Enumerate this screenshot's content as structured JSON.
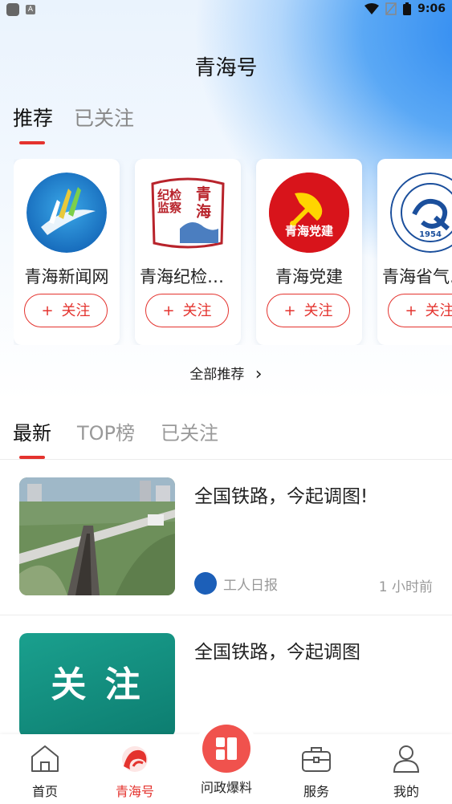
{
  "status_bar": {
    "time": "9:06",
    "left_badge": "A"
  },
  "header": {
    "title": "青海号"
  },
  "top_tabs": [
    {
      "label": "推荐",
      "active": true
    },
    {
      "label": "已关注",
      "active": false
    }
  ],
  "recommend_cards": [
    {
      "name": "青海新闻网",
      "follow_label": "关注",
      "plus": "+"
    },
    {
      "name": "青海纪检监察",
      "follow_label": "关注",
      "plus": "+"
    },
    {
      "name": "青海党建",
      "follow_label": "关注",
      "plus": "+"
    },
    {
      "name": "青海省气象局",
      "follow_label": "关注",
      "plus": "+"
    }
  ],
  "logo_texts": {
    "jijian_left": "纪检监察",
    "jijian_right": "青海",
    "dangjian": "青海党建",
    "qixiang_year": "1954"
  },
  "all_recommend": {
    "label": "全部推荐",
    "arrow": "›"
  },
  "section_tabs": [
    {
      "label": "最新",
      "active": true
    },
    {
      "label": "TOP榜",
      "active": false
    },
    {
      "label": "已关注",
      "active": false
    }
  ],
  "news": [
    {
      "title": "全国铁路，今起调图!",
      "source": "工人日报",
      "time": "1  小时前"
    },
    {
      "title": "全国铁路，今起调图",
      "thumb_text": "关 注"
    }
  ],
  "bottom_nav": [
    {
      "label": "首页",
      "icon": "home-icon"
    },
    {
      "label": "青海号",
      "icon": "qinghai-hao-icon",
      "active": true
    },
    {
      "label": "问政爆料",
      "icon": "report-icon"
    },
    {
      "label": "服务",
      "icon": "briefcase-icon"
    },
    {
      "label": "我的",
      "icon": "person-icon"
    }
  ],
  "colors": {
    "accent": "#e4332e",
    "center_button": "#f0524d"
  }
}
